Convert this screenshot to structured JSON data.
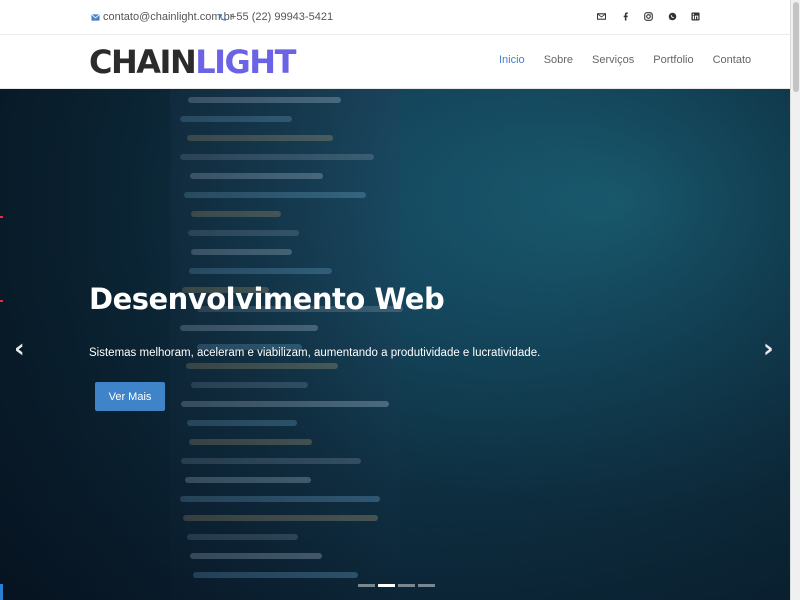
{
  "topbar": {
    "email": "contato@chainlight.com.br",
    "phone": "+55 (22) 99943-5421",
    "social_icons": [
      "email-icon",
      "facebook-icon",
      "instagram-icon",
      "whatsapp-icon",
      "linkedin-icon"
    ]
  },
  "brand": {
    "logo_part1": "CHAIN",
    "logo_part2": "LIGHT",
    "color_dark": "#2b2b2b",
    "color_accent": "#6b63e6"
  },
  "nav": {
    "items": [
      {
        "label": "Inicio",
        "active": true
      },
      {
        "label": "Sobre",
        "active": false
      },
      {
        "label": "Serviços",
        "active": false
      },
      {
        "label": "Portfolio",
        "active": false
      },
      {
        "label": "Contato",
        "active": false
      }
    ],
    "active_color": "#4a7fc4"
  },
  "hero": {
    "title": "Desenvolvimento Web",
    "subtitle": "Sistemas melhoram, aceleram e viabilizam, aumentando a produtividade e lucratividade.",
    "button_label": "Ver Mais",
    "button_color": "#3f84c9",
    "prev_arrow": "‹",
    "next_arrow": "›",
    "slide_count": 4,
    "active_slide": 2
  }
}
